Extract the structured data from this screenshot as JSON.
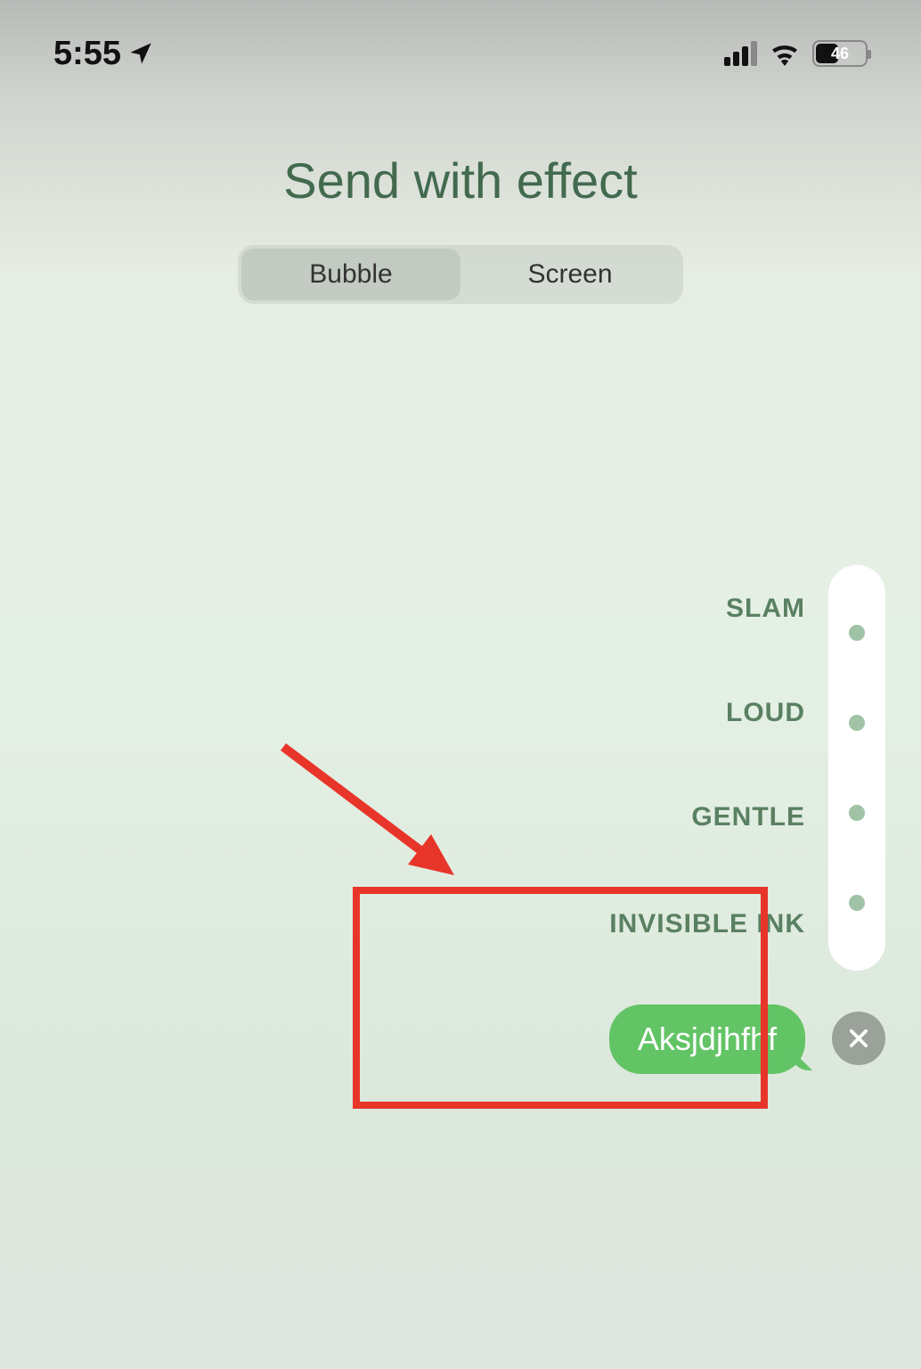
{
  "status": {
    "time": "5:55",
    "battery": "46"
  },
  "title": "Send with effect",
  "tabs": {
    "bubble": "Bubble",
    "screen": "Screen"
  },
  "effects": {
    "slam": "SLAM",
    "loud": "LOUD",
    "gentle": "GENTLE",
    "ink": "INVISIBLE INK"
  },
  "message": {
    "text": "Aksjdjhfhf"
  }
}
